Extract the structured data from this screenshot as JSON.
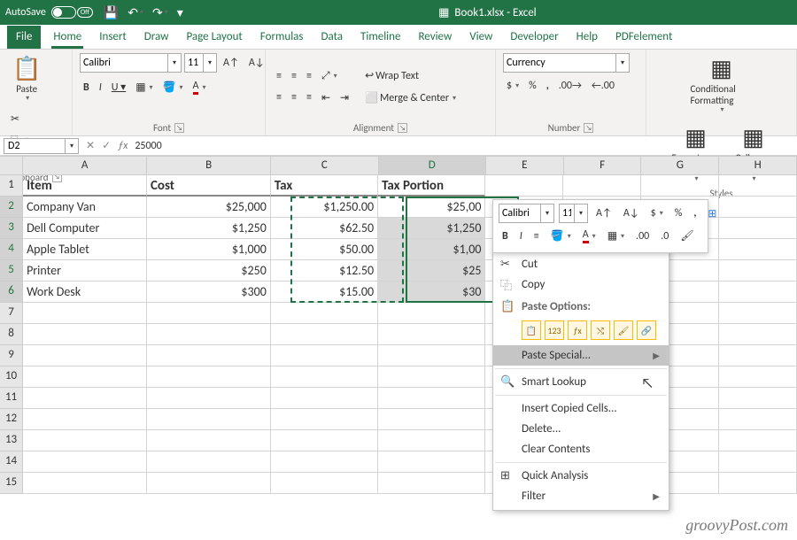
{
  "titlebar": {
    "autosave": "AutoSave",
    "autosave_state": "Off",
    "title": "Book1.xlsx - Excel"
  },
  "tabs": [
    "File",
    "Home",
    "Insert",
    "Draw",
    "Page Layout",
    "Formulas",
    "Data",
    "Timeline",
    "Review",
    "View",
    "Developer",
    "Help",
    "PDFelement"
  ],
  "active_tab": "Home",
  "ribbon": {
    "clipboard": {
      "paste": "Paste",
      "label": "Clipboard"
    },
    "font": {
      "name": "Calibri",
      "size": "11",
      "label": "Font"
    },
    "alignment": {
      "wrap": "Wrap Text",
      "merge": "Merge & Center",
      "label": "Alignment"
    },
    "number": {
      "format": "Currency",
      "label": "Number"
    },
    "styles": {
      "cf": "Conditional Formatting",
      "fat": "Format as Table",
      "cs": "Cell Styles",
      "label": "Styles"
    }
  },
  "name_box": "D2",
  "formula": "25000",
  "columns": [
    "A",
    "B",
    "C",
    "D",
    "E",
    "F",
    "G",
    "H"
  ],
  "headers": [
    "Item",
    "Cost",
    "Tax",
    "Tax Portion"
  ],
  "rows": [
    {
      "item": "Company Van",
      "cost": "$25,000",
      "tax": "$1,250.00",
      "portion": "$25,00"
    },
    {
      "item": "Dell Computer",
      "cost": "$1,250",
      "tax": "$62.50",
      "portion": "$1,250"
    },
    {
      "item": "Apple Tablet",
      "cost": "$1,000",
      "tax": "$50.00",
      "portion": "$1,00"
    },
    {
      "item": "Printer",
      "cost": "$250",
      "tax": "$12.50",
      "portion": "$25"
    },
    {
      "item": "Work Desk",
      "cost": "$300",
      "tax": "$15.00",
      "portion": "$30"
    }
  ],
  "mini": {
    "font": "Calibri",
    "size": "11"
  },
  "ctx": {
    "cut": "Cut",
    "copy": "Copy",
    "paste_opts": "Paste Options:",
    "paste_special": "Paste Special...",
    "smart": "Smart Lookup",
    "insert": "Insert Copied Cells...",
    "delete": "Delete...",
    "clear": "Clear Contents",
    "quick": "Quick Analysis",
    "filter": "Filter"
  },
  "watermark": "groovyPost.com"
}
